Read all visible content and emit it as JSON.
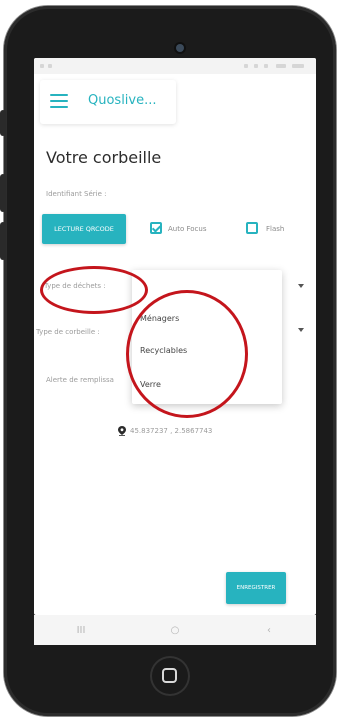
{
  "app": {
    "title": "Quoslive..."
  },
  "page": {
    "title": "Votre corbeille"
  },
  "form": {
    "serial_label": "Identifiant Série :",
    "qrcode_button": "LECTURE QRCODE",
    "autofocus_label": "Auto Focus",
    "autofocus_checked": true,
    "flash_label": "Flash",
    "flash_checked": false,
    "waste_type_label": "Type de déchets :",
    "bin_type_label": "Type de corbeille :",
    "fill_alert_label": "Alerte de remplissa"
  },
  "dropdown": {
    "options": [
      "Ménagers",
      "Recyclables",
      "Verre"
    ]
  },
  "location": {
    "coords": "45.837237 , 2.5867743",
    "icon": "map-pin-icon"
  },
  "actions": {
    "save_label": "ENREGISTRER"
  },
  "navbar": {
    "recent": "III",
    "home": "○",
    "back": "‹"
  },
  "colors": {
    "accent": "#27b3bf",
    "annotation": "#c4151c",
    "phone": "#1b1b1b"
  }
}
